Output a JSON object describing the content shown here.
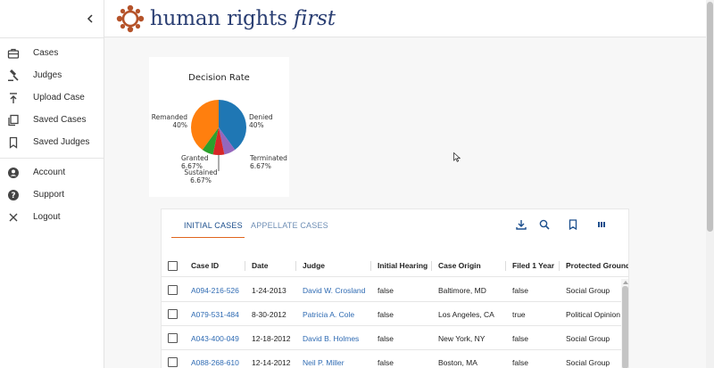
{
  "brand": {
    "name_main": "human rights ",
    "name_emph": "first",
    "mark_color": "#b5532a",
    "text_color": "#2b3f73"
  },
  "sidebar": {
    "items": [
      {
        "label": "Cases",
        "icon": "briefcase-icon"
      },
      {
        "label": "Judges",
        "icon": "gavel-icon"
      },
      {
        "label": "Upload Case",
        "icon": "upload-icon"
      },
      {
        "label": "Saved Cases",
        "icon": "saved-cases-icon"
      },
      {
        "label": "Saved Judges",
        "icon": "bookmark-icon"
      }
    ],
    "account_items": [
      {
        "label": "Account",
        "icon": "account-icon"
      },
      {
        "label": "Support",
        "icon": "help-icon"
      },
      {
        "label": "Logout",
        "icon": "close-icon"
      }
    ]
  },
  "chart_data": {
    "type": "pie",
    "title": "Decision Rate",
    "slices": [
      {
        "label": "Denied",
        "value": 40,
        "value_label": "40%",
        "color": "#1f77b4"
      },
      {
        "label": "Terminated",
        "value": 6.67,
        "value_label": "6.67%",
        "color": "#9467bd"
      },
      {
        "label": "Sustained",
        "value": 6.67,
        "value_label": "6.67%",
        "color": "#d62728"
      },
      {
        "label": "Granted",
        "value": 6.67,
        "value_label": "6.67%",
        "color": "#2ca02c"
      },
      {
        "label": "Remanded",
        "value": 40,
        "value_label": "40%",
        "color": "#ff7f0e"
      }
    ]
  },
  "tabs": [
    {
      "label": "INITIAL CASES",
      "active": true
    },
    {
      "label": "APPELLATE CASES",
      "active": false
    }
  ],
  "accent_color": "#e0651d",
  "table": {
    "columns": [
      "Case ID",
      "Date",
      "Judge",
      "Initial Hearing",
      "Case Origin",
      "Filed 1 Year",
      "Protected Ground"
    ],
    "rows": [
      [
        "A094-216-526",
        "1-24-2013",
        "David W. Crosland",
        "false",
        "Baltimore, MD",
        "false",
        "Social Group"
      ],
      [
        "A079-531-484",
        "8-30-2012",
        "Patricia A. Cole",
        "false",
        "Los Angeles, CA",
        "true",
        "Political Opinion"
      ],
      [
        "A043-400-049",
        "12-18-2012",
        "David B. Holmes",
        "false",
        "New York, NY",
        "false",
        "Social Group"
      ],
      [
        "A088-268-610",
        "12-14-2012",
        "Neil P. Miller",
        "false",
        "Boston, MA",
        "false",
        "Social Group"
      ]
    ]
  }
}
